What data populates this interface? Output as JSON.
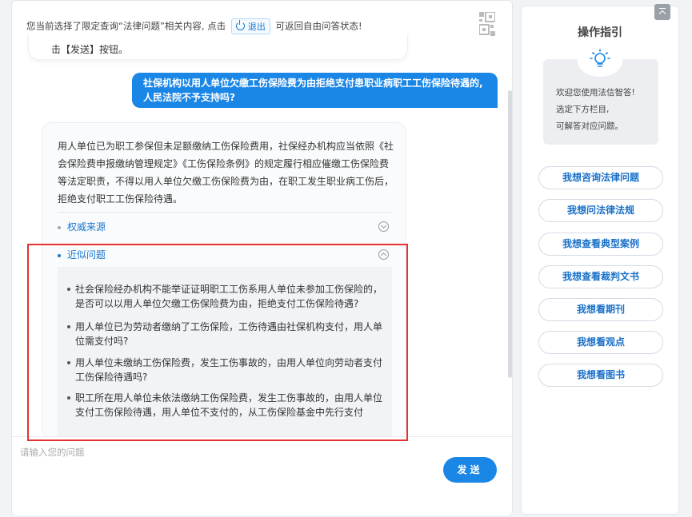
{
  "notice": {
    "prefix": "您当前选择了限定查询“法律问题”相关内容, 点击",
    "exit_label": "退出",
    "suffix": "可返回自由问答状态!"
  },
  "chat": {
    "prev_bubble_tail": "击【发送】按钮。",
    "user_question": "社保机构以用人单位欠缴工伤保险费为由拒绝支付患职业病职工工伤保险待遇的,人民法院不予支持吗?",
    "answer": "用人单位已为职工参保但未足额缴纳工伤保险费用，社保经办机构应当依照《社会保险费申报缴纳管理规定》《工伤保险条例》的规定履行相应催缴工伤保险费等法定职责，不得以用人单位欠缴工伤保险费为由，在职工发生职业病工伤后，拒绝支付职工工伤保险待遇。",
    "sections": {
      "authority_label": "权威来源",
      "similar_label": "近似问题"
    },
    "similar_questions": [
      "社会保险经办机构不能举证证明职工工伤系用人单位未参加工伤保险的，是否可以以用人单位欠缴工伤保险费为由，拒绝支付工伤保险待遇?",
      "用人单位已为劳动者缴纳了工伤保险，工伤待遇由社保机构支付，用人单位需支付吗?",
      "用人单位未缴纳工伤保险费，发生工伤事故的，由用人单位向劳动者支付工伤保险待遇吗?",
      "职工所在用人单位未依法缴纳工伤保险费，发生工伤事故的，由用人单位支付工伤保险待遇，用人单位不支付的，从工伤保险基金中先行支付"
    ]
  },
  "input": {
    "placeholder": "请输入您的问题",
    "send_label": "发送"
  },
  "guide": {
    "title": "操作指引",
    "welcome_lines": [
      "欢迎您使用法信智答!",
      "选定下方栏目,",
      "可解答对应问题。"
    ],
    "buttons": [
      "我想咨询法律问题",
      "我想问法律法规",
      "我想查看典型案例",
      "我想查看裁判文书",
      "我想看期刊",
      "我想看观点",
      "我想看图书"
    ]
  },
  "colors": {
    "accent": "#1a86e6",
    "highlight_border": "#e63232"
  }
}
